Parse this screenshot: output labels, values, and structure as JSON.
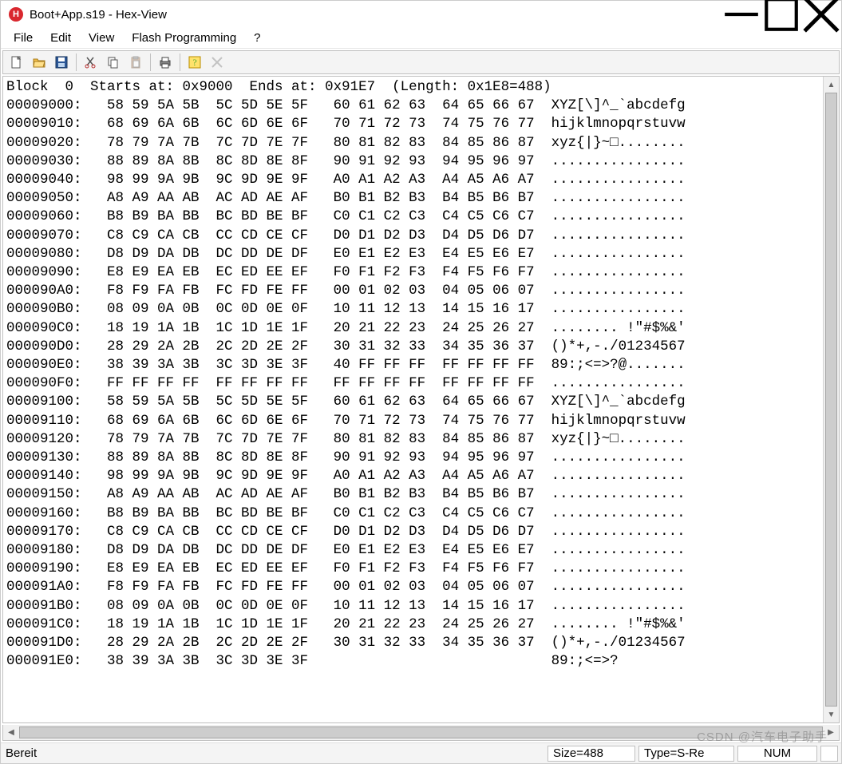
{
  "window": {
    "title": "Boot+App.s19 - Hex-View",
    "app_icon_letter": "H"
  },
  "menu": {
    "file": "File",
    "edit": "Edit",
    "view": "View",
    "flash": "Flash Programming",
    "help": "?"
  },
  "toolbar_icons": {
    "new": "new-file-icon",
    "open": "open-folder-icon",
    "save": "save-icon",
    "cut": "cut-icon",
    "copy": "copy-icon",
    "paste": "paste-icon",
    "print": "print-icon",
    "help": "help-icon",
    "delete": "delete-icon"
  },
  "status": {
    "ready": "Bereit",
    "size": "Size=488",
    "type": "Type=S-Re",
    "num": "NUM"
  },
  "watermark": "CSDN @汽车电子助手",
  "hex": {
    "header": "Block  0  Starts at: 0x9000  Ends at: 0x91E7  (Length: 0x1E8=488)",
    "rows": [
      {
        "addr": "00009000:",
        "g1": "58 59 5A 5B",
        "g2": "5C 5D 5E 5F",
        "g3": "60 61 62 63",
        "g4": "64 65 66 67",
        "ascii": "XYZ[\\]^_`abcdefg"
      },
      {
        "addr": "00009010:",
        "g1": "68 69 6A 6B",
        "g2": "6C 6D 6E 6F",
        "g3": "70 71 72 73",
        "g4": "74 75 76 77",
        "ascii": "hijklmnopqrstuvw"
      },
      {
        "addr": "00009020:",
        "g1": "78 79 7A 7B",
        "g2": "7C 7D 7E 7F",
        "g3": "80 81 82 83",
        "g4": "84 85 86 87",
        "ascii": "xyz{|}~□........"
      },
      {
        "addr": "00009030:",
        "g1": "88 89 8A 8B",
        "g2": "8C 8D 8E 8F",
        "g3": "90 91 92 93",
        "g4": "94 95 96 97",
        "ascii": "................"
      },
      {
        "addr": "00009040:",
        "g1": "98 99 9A 9B",
        "g2": "9C 9D 9E 9F",
        "g3": "A0 A1 A2 A3",
        "g4": "A4 A5 A6 A7",
        "ascii": "................"
      },
      {
        "addr": "00009050:",
        "g1": "A8 A9 AA AB",
        "g2": "AC AD AE AF",
        "g3": "B0 B1 B2 B3",
        "g4": "B4 B5 B6 B7",
        "ascii": "................"
      },
      {
        "addr": "00009060:",
        "g1": "B8 B9 BA BB",
        "g2": "BC BD BE BF",
        "g3": "C0 C1 C2 C3",
        "g4": "C4 C5 C6 C7",
        "ascii": "................"
      },
      {
        "addr": "00009070:",
        "g1": "C8 C9 CA CB",
        "g2": "CC CD CE CF",
        "g3": "D0 D1 D2 D3",
        "g4": "D4 D5 D6 D7",
        "ascii": "................"
      },
      {
        "addr": "00009080:",
        "g1": "D8 D9 DA DB",
        "g2": "DC DD DE DF",
        "g3": "E0 E1 E2 E3",
        "g4": "E4 E5 E6 E7",
        "ascii": "................"
      },
      {
        "addr": "00009090:",
        "g1": "E8 E9 EA EB",
        "g2": "EC ED EE EF",
        "g3": "F0 F1 F2 F3",
        "g4": "F4 F5 F6 F7",
        "ascii": "................"
      },
      {
        "addr": "000090A0:",
        "g1": "F8 F9 FA FB",
        "g2": "FC FD FE FF",
        "g3": "00 01 02 03",
        "g4": "04 05 06 07",
        "ascii": "................"
      },
      {
        "addr": "000090B0:",
        "g1": "08 09 0A 0B",
        "g2": "0C 0D 0E 0F",
        "g3": "10 11 12 13",
        "g4": "14 15 16 17",
        "ascii": "................"
      },
      {
        "addr": "000090C0:",
        "g1": "18 19 1A 1B",
        "g2": "1C 1D 1E 1F",
        "g3": "20 21 22 23",
        "g4": "24 25 26 27",
        "ascii": "........ !\"#$%&'"
      },
      {
        "addr": "000090D0:",
        "g1": "28 29 2A 2B",
        "g2": "2C 2D 2E 2F",
        "g3": "30 31 32 33",
        "g4": "34 35 36 37",
        "ascii": "()*+,-./01234567"
      },
      {
        "addr": "000090E0:",
        "g1": "38 39 3A 3B",
        "g2": "3C 3D 3E 3F",
        "g3": "40 FF FF FF",
        "g4": "FF FF FF FF",
        "ascii": "89:;<=>?@......."
      },
      {
        "addr": "000090F0:",
        "g1": "FF FF FF FF",
        "g2": "FF FF FF FF",
        "g3": "FF FF FF FF",
        "g4": "FF FF FF FF",
        "ascii": "................"
      },
      {
        "addr": "00009100:",
        "g1": "58 59 5A 5B",
        "g2": "5C 5D 5E 5F",
        "g3": "60 61 62 63",
        "g4": "64 65 66 67",
        "ascii": "XYZ[\\]^_`abcdefg"
      },
      {
        "addr": "00009110:",
        "g1": "68 69 6A 6B",
        "g2": "6C 6D 6E 6F",
        "g3": "70 71 72 73",
        "g4": "74 75 76 77",
        "ascii": "hijklmnopqrstuvw"
      },
      {
        "addr": "00009120:",
        "g1": "78 79 7A 7B",
        "g2": "7C 7D 7E 7F",
        "g3": "80 81 82 83",
        "g4": "84 85 86 87",
        "ascii": "xyz{|}~□........"
      },
      {
        "addr": "00009130:",
        "g1": "88 89 8A 8B",
        "g2": "8C 8D 8E 8F",
        "g3": "90 91 92 93",
        "g4": "94 95 96 97",
        "ascii": "................"
      },
      {
        "addr": "00009140:",
        "g1": "98 99 9A 9B",
        "g2": "9C 9D 9E 9F",
        "g3": "A0 A1 A2 A3",
        "g4": "A4 A5 A6 A7",
        "ascii": "................"
      },
      {
        "addr": "00009150:",
        "g1": "A8 A9 AA AB",
        "g2": "AC AD AE AF",
        "g3": "B0 B1 B2 B3",
        "g4": "B4 B5 B6 B7",
        "ascii": "................"
      },
      {
        "addr": "00009160:",
        "g1": "B8 B9 BA BB",
        "g2": "BC BD BE BF",
        "g3": "C0 C1 C2 C3",
        "g4": "C4 C5 C6 C7",
        "ascii": "................"
      },
      {
        "addr": "00009170:",
        "g1": "C8 C9 CA CB",
        "g2": "CC CD CE CF",
        "g3": "D0 D1 D2 D3",
        "g4": "D4 D5 D6 D7",
        "ascii": "................"
      },
      {
        "addr": "00009180:",
        "g1": "D8 D9 DA DB",
        "g2": "DC DD DE DF",
        "g3": "E0 E1 E2 E3",
        "g4": "E4 E5 E6 E7",
        "ascii": "................"
      },
      {
        "addr": "00009190:",
        "g1": "E8 E9 EA EB",
        "g2": "EC ED EE EF",
        "g3": "F0 F1 F2 F3",
        "g4": "F4 F5 F6 F7",
        "ascii": "................"
      },
      {
        "addr": "000091A0:",
        "g1": "F8 F9 FA FB",
        "g2": "FC FD FE FF",
        "g3": "00 01 02 03",
        "g4": "04 05 06 07",
        "ascii": "................"
      },
      {
        "addr": "000091B0:",
        "g1": "08 09 0A 0B",
        "g2": "0C 0D 0E 0F",
        "g3": "10 11 12 13",
        "g4": "14 15 16 17",
        "ascii": "................"
      },
      {
        "addr": "000091C0:",
        "g1": "18 19 1A 1B",
        "g2": "1C 1D 1E 1F",
        "g3": "20 21 22 23",
        "g4": "24 25 26 27",
        "ascii": "........ !\"#$%&'"
      },
      {
        "addr": "000091D0:",
        "g1": "28 29 2A 2B",
        "g2": "2C 2D 2E 2F",
        "g3": "30 31 32 33",
        "g4": "34 35 36 37",
        "ascii": "()*+,-./01234567"
      },
      {
        "addr": "000091E0:",
        "g1": "38 39 3A 3B",
        "g2": "3C 3D 3E 3F",
        "g3": "",
        "g4": "",
        "ascii": "89:;<=>?"
      }
    ]
  }
}
